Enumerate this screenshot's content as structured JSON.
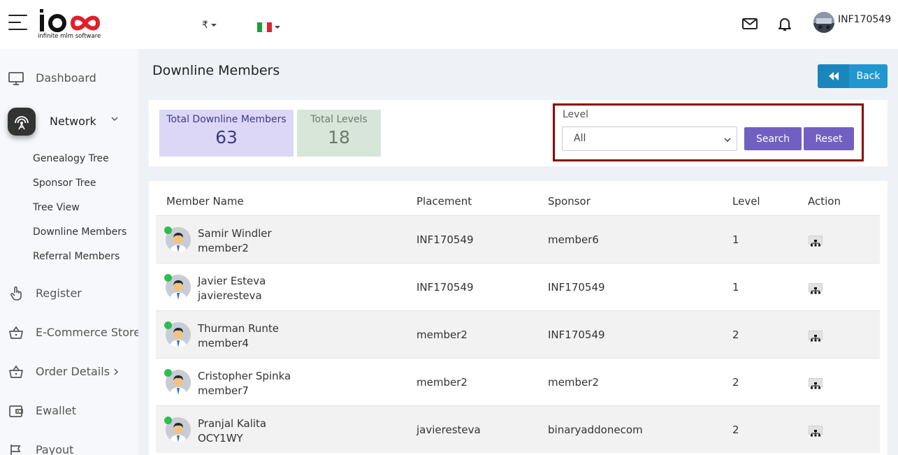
{
  "header": {
    "logo_text": "ioco",
    "logo_sub": "infinite mlm software",
    "currency": "₹",
    "username": "INF170549"
  },
  "sidebar": {
    "items": [
      {
        "label": "Dashboard",
        "icon": "monitor-icon"
      },
      {
        "label": "Network",
        "icon": "network-icon"
      },
      {
        "label": "Register",
        "icon": "hand-pointer-icon"
      },
      {
        "label": "E-Commerce Store",
        "icon": "basket-icon"
      },
      {
        "label": "Order Details",
        "icon": "basket-icon"
      },
      {
        "label": "Ewallet",
        "icon": "wallet-icon"
      },
      {
        "label": "Payout",
        "icon": "payout-icon"
      }
    ],
    "network_sub": [
      "Genealogy Tree",
      "Sponsor Tree",
      "Tree View",
      "Downline Members",
      "Referral Members"
    ]
  },
  "page": {
    "title": "Downline Members",
    "back_label": "Back"
  },
  "stats": {
    "total_members_label": "Total Downline Members",
    "total_members_value": "63",
    "total_levels_label": "Total Levels",
    "total_levels_value": "18"
  },
  "filter": {
    "label": "Level",
    "selected": "All",
    "search_label": "Search",
    "reset_label": "Reset"
  },
  "table": {
    "columns": [
      "Member Name",
      "Placement",
      "Sponsor",
      "Level",
      "Action"
    ],
    "rows": [
      {
        "name": "Samir Windler",
        "username": "member2",
        "placement": "INF170549",
        "sponsor": "member6",
        "level": "1"
      },
      {
        "name": "Javier Esteva",
        "username": "javieresteva",
        "placement": "INF170549",
        "sponsor": "INF170549",
        "level": "1"
      },
      {
        "name": "Thurman Runte",
        "username": "member4",
        "placement": "member2",
        "sponsor": "INF170549",
        "level": "2"
      },
      {
        "name": "Cristopher Spinka",
        "username": "member7",
        "placement": "member2",
        "sponsor": "member2",
        "level": "2"
      },
      {
        "name": "Pranjal Kalita",
        "username": "OCY1WY",
        "placement": "javieresteva",
        "sponsor": "binaryaddonecom",
        "level": "2"
      }
    ]
  },
  "colors": {
    "accent_purple": "#7160c2",
    "back_blue": "#2196cf",
    "highlight_border": "#8b0000",
    "online_green": "#2ebd4f"
  }
}
